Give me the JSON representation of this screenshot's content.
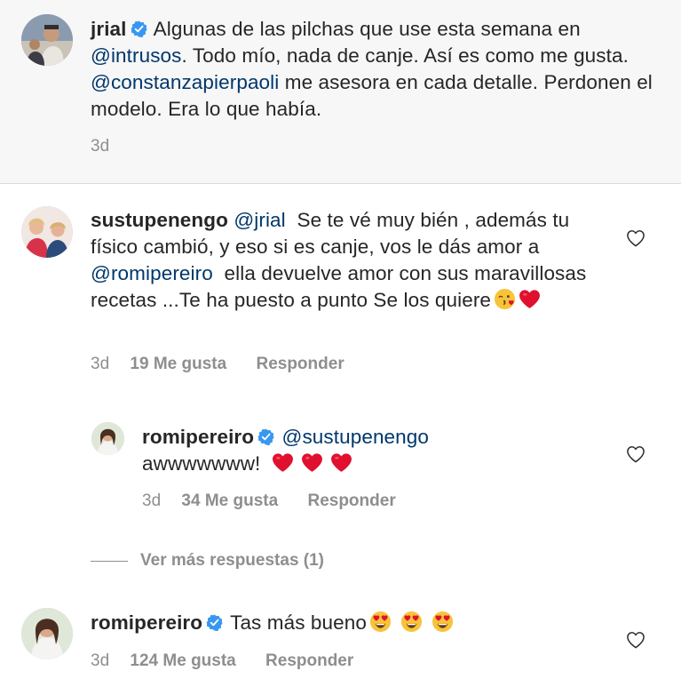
{
  "caption": {
    "username": "jrial",
    "text_part1": "Algunas de las pilchas que use esta semana en",
    "mention1": "@intrusos",
    "text_part2": ". Todo mío, nada de canje. Así es como me gusta.",
    "mention2": "@constanzapierpaoli",
    "text_part3": "me asesora en cada detalle. Perdonen el modelo. Era lo que había.",
    "time": "3d"
  },
  "comment1": {
    "username": "sustupenengo",
    "mention1": "@jrial",
    "text_part1": "Se te vé muy bién , además tu físico cambió, y eso si es canje, vos le dás amor a",
    "mention2": "@romipereiro",
    "text_part2": "ella devuelve amor con sus maravillosas recetas ...Te ha puesto a punto Se los quiere",
    "emojis": [
      "kiss-emoji",
      "red-heart-emoji"
    ],
    "time": "3d",
    "likes": "19 Me gusta",
    "reply_label": "Responder"
  },
  "reply1": {
    "username": "romipereiro",
    "mention": "@sustupenengo",
    "text": "awwwwwww!",
    "emojis": [
      "red-heart-emoji",
      "red-heart-emoji",
      "red-heart-emoji"
    ],
    "time": "3d",
    "likes": "34 Me gusta",
    "reply_label": "Responder"
  },
  "more_replies": "Ver más respuestas (1)",
  "comment2": {
    "username": "romipereiro",
    "text": "Tas más bueno",
    "emojis": [
      "heart-eyes-emoji",
      "heart-eyes-emoji",
      "heart-eyes-emoji"
    ],
    "time": "3d",
    "likes": "124 Me gusta",
    "reply_label": "Responder"
  },
  "colors": {
    "mention": "#00376b",
    "meta": "#8e8e8e",
    "verified": "#3897f0",
    "heart_emoji": "#e0102f"
  }
}
